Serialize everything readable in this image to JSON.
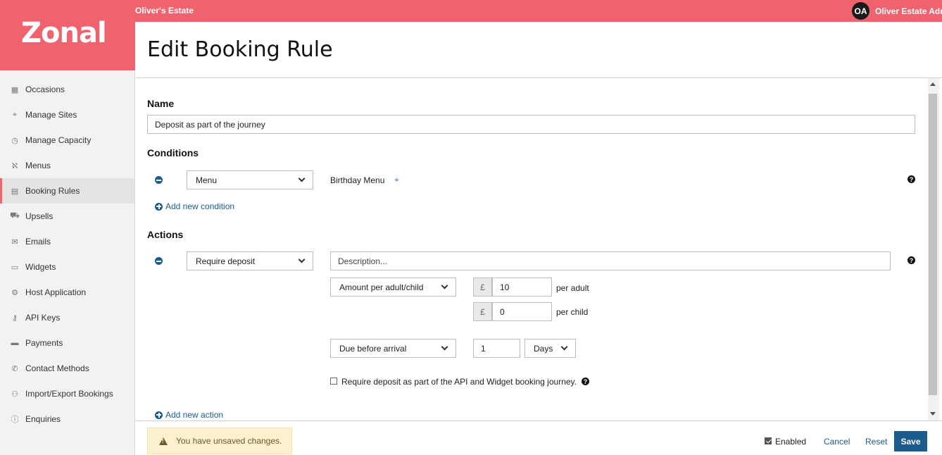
{
  "topbar": {
    "estate": "Oliver's Estate",
    "avatar_initials": "OA",
    "user_name": "Oliver Estate Adm"
  },
  "logo": "Zonal",
  "sidebar": {
    "items": [
      {
        "label": "Occasions",
        "icon": "calendar-icon",
        "glyph": "▦"
      },
      {
        "label": "Manage Sites",
        "icon": "map-pin-icon",
        "glyph": "⌖"
      },
      {
        "label": "Manage Capacity",
        "icon": "clock-icon",
        "glyph": "◷"
      },
      {
        "label": "Menus",
        "icon": "cutlery-icon",
        "glyph": "ℵ"
      },
      {
        "label": "Booking Rules",
        "icon": "rules-list-icon",
        "glyph": "▤"
      },
      {
        "label": "Upsells",
        "icon": "cart-icon",
        "glyph": "⛟"
      },
      {
        "label": "Emails",
        "icon": "envelope-icon",
        "glyph": "✉"
      },
      {
        "label": "Widgets",
        "icon": "window-icon",
        "glyph": "▭"
      },
      {
        "label": "Host Application",
        "icon": "gears-icon",
        "glyph": "⚙"
      },
      {
        "label": "API Keys",
        "icon": "key-icon",
        "glyph": "⚷"
      },
      {
        "label": "Payments",
        "icon": "credit-card-icon",
        "glyph": "▬"
      },
      {
        "label": "Contact Methods",
        "icon": "phone-icon",
        "glyph": "✆"
      },
      {
        "label": "Import/Export Bookings",
        "icon": "user-transfer-icon",
        "glyph": "⚇"
      },
      {
        "label": "Enquiries",
        "icon": "info-icon",
        "glyph": "ⓘ"
      }
    ],
    "active_index": 4
  },
  "page": {
    "title": "Edit Booking Rule"
  },
  "name_section": {
    "title": "Name",
    "value": "Deposit as part of the journey"
  },
  "conditions": {
    "title": "Conditions",
    "condition_type": "Menu",
    "condition_value": "Birthday Menu",
    "add_label": "Add new condition"
  },
  "actions": {
    "title": "Actions",
    "action_type": "Require deposit",
    "description_placeholder": "Description...",
    "amount_type": "Amount per adult/child",
    "currency_symbol": "£",
    "per_adult_value": "10",
    "per_adult_label": "per adult",
    "per_child_value": "0",
    "per_child_label": "per child",
    "due_type": "Due before arrival",
    "due_amount": "1",
    "due_unit": "Days",
    "api_widget_label": "Require deposit as part of the API and Widget booking journey.",
    "api_widget_checked": false,
    "add_label": "Add new action"
  },
  "footer": {
    "unsaved_message": "You have unsaved changes.",
    "enabled_label": "Enabled",
    "enabled_checked": true,
    "cancel_label": "Cancel",
    "reset_label": "Reset",
    "save_label": "Save"
  }
}
